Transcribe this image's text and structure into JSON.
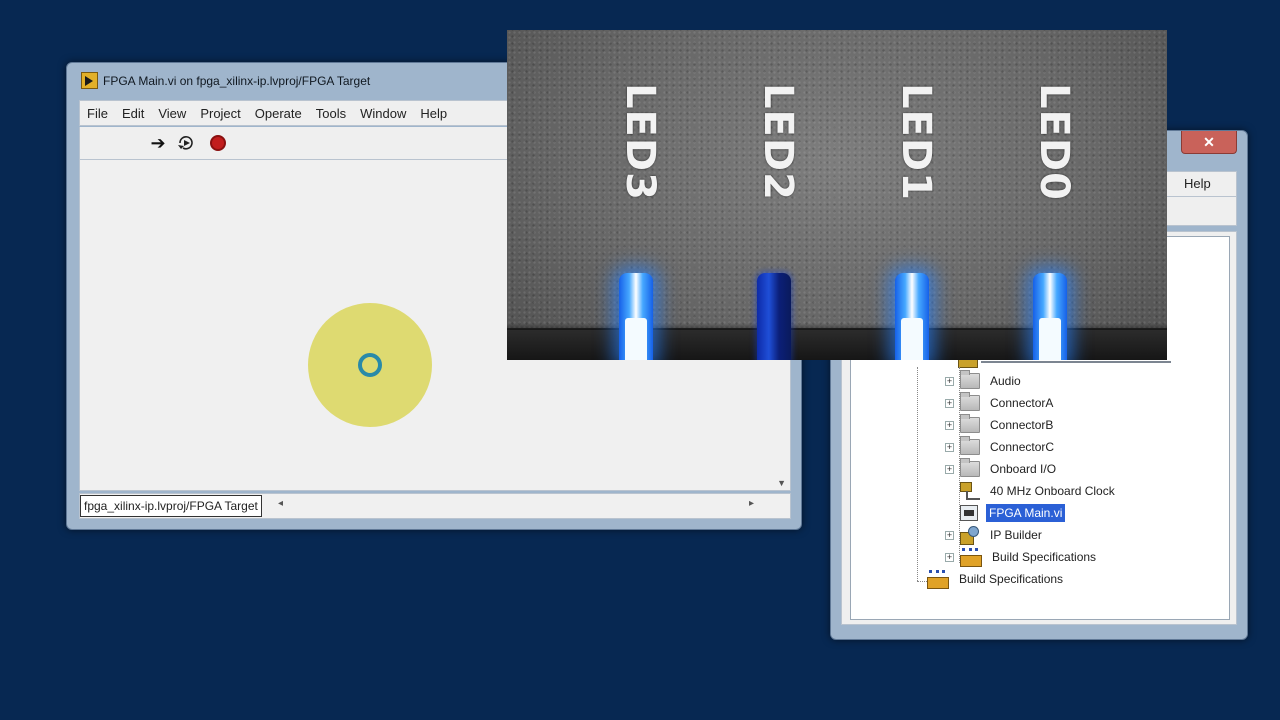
{
  "vi_window": {
    "title": "FPGA Main.vi on fpga_xilinx-ip.lvproj/FPGA Target",
    "menu": [
      "File",
      "Edit",
      "View",
      "Project",
      "Operate",
      "Tools",
      "Window",
      "Help"
    ],
    "toolbar": {
      "run": "run-arrow-icon",
      "run_continuously": "run-continuously-icon",
      "abort": "abort-icon"
    },
    "status_target": "fpga_xilinx-ip.lvproj/FPGA Target"
  },
  "project_window": {
    "close_glyph": "✕",
    "help_menu": "Help",
    "tree": [
      {
        "label": "Audio",
        "icon": "folder-icon",
        "expander": "+"
      },
      {
        "label": "ConnectorA",
        "icon": "folder-icon",
        "expander": "+"
      },
      {
        "label": "ConnectorB",
        "icon": "folder-icon",
        "expander": "+"
      },
      {
        "label": "ConnectorC",
        "icon": "folder-icon",
        "expander": "+"
      },
      {
        "label": "Onboard I/O",
        "icon": "folder-icon",
        "expander": "+"
      },
      {
        "label": "40 MHz Onboard Clock",
        "icon": "clock-icon"
      },
      {
        "label": "FPGA Main.vi",
        "icon": "vi-icon",
        "selected": true
      },
      {
        "label": "IP Builder",
        "icon": "ip-builder-icon",
        "expander": "+"
      },
      {
        "label": "Build Specifications",
        "icon": "build-spec-icon",
        "expander": "+"
      },
      {
        "label": "Build Specifications",
        "icon": "build-spec-icon"
      }
    ]
  },
  "led_photo": {
    "labels": [
      "LED3",
      "LED2",
      "LED1",
      "LED0"
    ],
    "states": [
      "on",
      "off",
      "on",
      "on"
    ],
    "led_on_color": "#46a8ff",
    "led_off_color": "#1f4fd8"
  },
  "colors": {
    "desktop": "#072852",
    "selection": "#2b60d6",
    "cursor_halo": "#dad65a"
  }
}
